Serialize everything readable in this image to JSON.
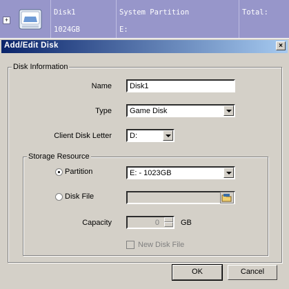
{
  "disk_row": {
    "name": "Disk1",
    "size": "1024GB",
    "partition_label": "System Partition",
    "partition_value": "E:",
    "total_label": "Total:",
    "expand_symbol": "+"
  },
  "dialog": {
    "title": "Add/Edit Disk",
    "close_symbol": "×",
    "disk_info": {
      "legend": "Disk Information",
      "name_label": "Name",
      "name_value": "Disk1",
      "type_label": "Type",
      "type_value": "Game Disk",
      "letter_label": "Client Disk Letter",
      "letter_value": "D:"
    },
    "storage": {
      "legend": "Storage Resource",
      "partition_label": "Partition",
      "partition_value": "E: - 1023GB",
      "partition_selected": true,
      "diskfile_label": "Disk File",
      "diskfile_value": "",
      "capacity_label": "Capacity",
      "capacity_value": "0",
      "capacity_unit": "GB",
      "new_disk_file_label": "New Disk File"
    },
    "buttons": {
      "ok": "OK",
      "cancel": "Cancel"
    }
  },
  "colors": {
    "row_bg": "#9796ca",
    "title_start": "#0a246a",
    "title_end": "#a6caf0",
    "face": "#d4d0c8"
  }
}
